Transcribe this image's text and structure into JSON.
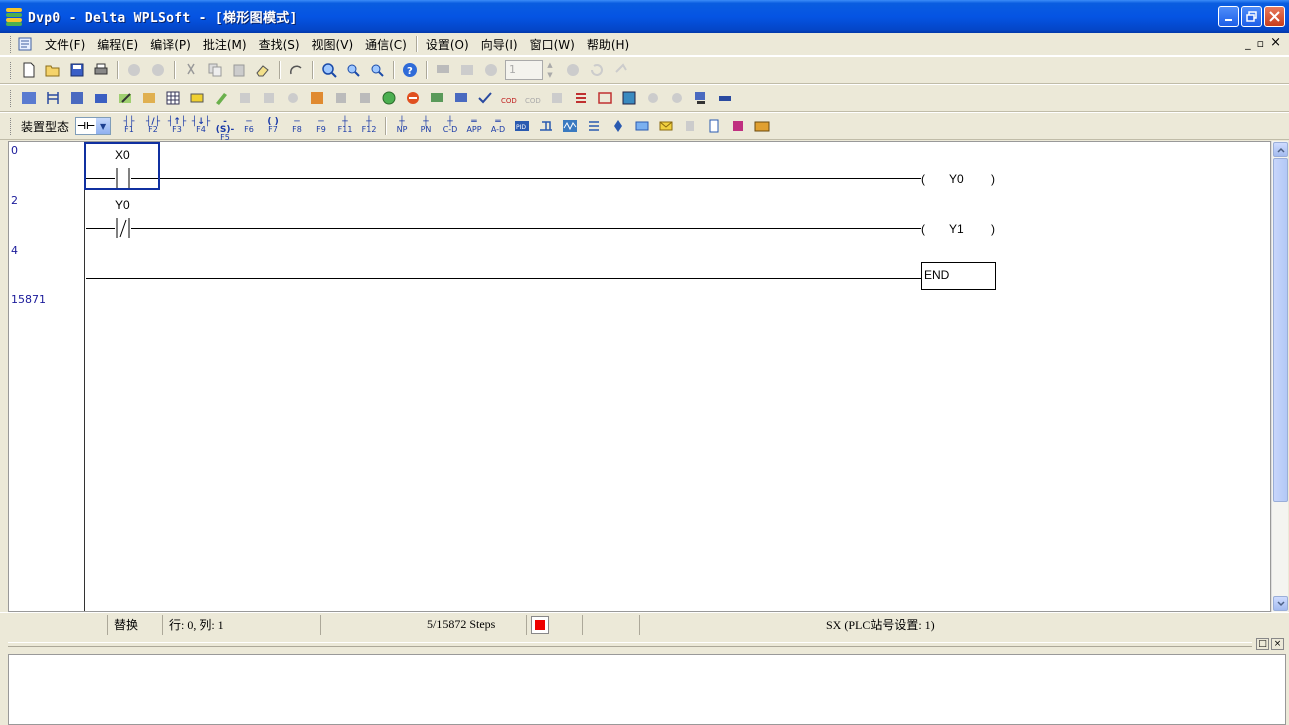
{
  "window": {
    "title": "Dvp0 - Delta WPLSoft - [梯形图模式]",
    "buttons": [
      "minimize",
      "restore",
      "close"
    ],
    "colors": {
      "titlebar": "#0554e3",
      "accent": "#1030a0"
    }
  },
  "menu": {
    "items": [
      "文件(F)",
      "编程(E)",
      "编译(P)",
      "批注(M)",
      "查找(S)",
      "视图(V)",
      "通信(C)",
      "设置(O)",
      "向导(I)",
      "窗口(W)",
      "帮助(H)"
    ],
    "mdi": [
      "_",
      "▫",
      "×"
    ]
  },
  "toolbar1": {
    "step_value": "1"
  },
  "toolbar3": {
    "device_label": "装置型态",
    "device_value": "⊣⊢",
    "fkeys": [
      {
        "sym": "┤├",
        "key": "F1"
      },
      {
        "sym": "┤/├",
        "key": "F2"
      },
      {
        "sym": "┤↑├",
        "key": "F3"
      },
      {
        "sym": "┤↓├",
        "key": "F4"
      },
      {
        "sym": "-(S)-",
        "key": "F5"
      },
      {
        "sym": "─",
        "key": "F6"
      },
      {
        "sym": "( )",
        "key": "F7"
      },
      {
        "sym": "─",
        "key": "F8"
      },
      {
        "sym": "─",
        "key": "F9"
      },
      {
        "sym": "┼",
        "key": "F11"
      },
      {
        "sym": "┼",
        "key": "F12"
      },
      {
        "sym": "┼",
        "key": "NP"
      },
      {
        "sym": "┼",
        "key": "PN"
      },
      {
        "sym": "┼",
        "key": "C-D"
      },
      {
        "sym": "═",
        "key": "APP"
      },
      {
        "sym": "═",
        "key": "A-D"
      }
    ]
  },
  "ladder": {
    "line_numbers": [
      "0",
      "2",
      "4",
      "15871"
    ],
    "rungs": [
      {
        "contact_label": "X0",
        "contact_type": "normally-open",
        "coil_open": "(",
        "coil": "Y0",
        "coil_close": ")"
      },
      {
        "contact_label": "Y0",
        "contact_type": "normally-closed",
        "coil_open": "(",
        "coil": "Y1",
        "coil_close": ")"
      },
      {
        "end_label": "END"
      }
    ]
  },
  "status": {
    "mode": "替换",
    "position": "行: 0, 列: 1",
    "steps": "5/15872 Steps",
    "plc": "SX (PLC站号设置: 1)",
    "run_color": "#e00000"
  },
  "output": {
    "buttons": [
      "□",
      "×"
    ]
  }
}
